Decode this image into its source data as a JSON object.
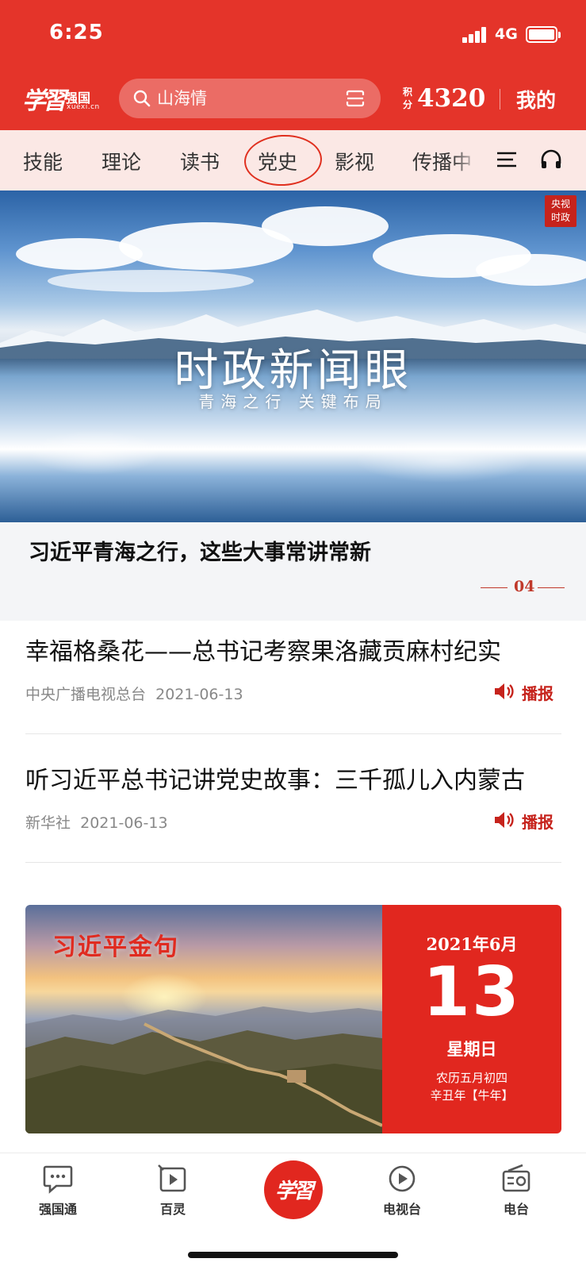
{
  "status_bar": {
    "time": "6:25",
    "network": "4G"
  },
  "header": {
    "logo_glyph": "学習",
    "logo_word": "强国",
    "logo_sub": "xuexi.cn",
    "search_placeholder": "山海情",
    "points_label": "积分",
    "points": "4320",
    "mine": "我的"
  },
  "tabs": [
    "技能",
    "理论",
    "读书",
    "党史",
    "影视",
    "传播中"
  ],
  "active_tab": "党史",
  "banner": {
    "badge": "央视\n时政",
    "title": "时政新闻眼",
    "subtitle": "青海之行 关键布局",
    "headline": "习近平青海之行，这些大事常讲常新",
    "page": "04"
  },
  "news": [
    {
      "title": "幸福格桑花——总书记考察果洛藏贡麻村纪实",
      "source": "中央广播电视总台",
      "date": "2021-06-13",
      "audio_label": "播报"
    },
    {
      "title": "听习近平总书记讲党史故事：三千孤儿入内蒙古",
      "source": "新华社",
      "date": "2021-06-13",
      "audio_label": "播报"
    }
  ],
  "quote_card": {
    "title": "习近平金句",
    "year_month": "2021年6月",
    "day": "13",
    "weekday": "星期日",
    "lunar_line1": "农历五月初四",
    "lunar_line2": "辛丑年【牛年】"
  },
  "bottom_nav": [
    {
      "label": "强国通",
      "icon": "chat-icon"
    },
    {
      "label": "百灵",
      "icon": "video-play-icon"
    },
    {
      "label": "学習",
      "icon": "xuexi-logo-icon"
    },
    {
      "label": "电视台",
      "icon": "tv-play-icon"
    },
    {
      "label": "电台",
      "icon": "radio-icon"
    }
  ],
  "colors": {
    "brand_red": "#e4342a",
    "tab_bg": "#fbe8e5",
    "accent_dark_red": "#c6231c"
  }
}
